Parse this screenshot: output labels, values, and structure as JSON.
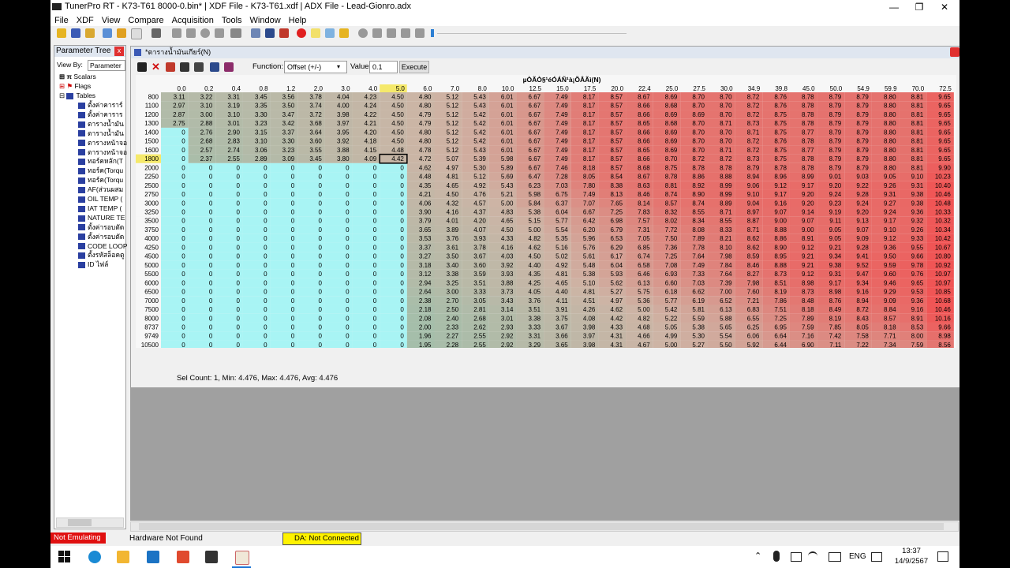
{
  "window": {
    "title": "TunerPro RT - K73-T61  8000-0.bin* | XDF File - K73-T61.xdf | ADX File - Lead-Gionro.adx",
    "minimize": "—",
    "maximize": "❐",
    "close": "✕"
  },
  "menu": [
    "File",
    "XDF",
    "View",
    "Compare",
    "Acquisition",
    "Tools",
    "Window",
    "Help"
  ],
  "param_tree": {
    "title": "Parameter Tree",
    "close": "x",
    "view_by_label": "View By:",
    "view_by_value": "Parameter",
    "groups": [
      "Scalars",
      "Flags",
      "Tables"
    ],
    "tables": [
      "ตั้งค่าคาราร์",
      "ตั้งค่าคาราร",
      "ตารางน้ำมัน",
      "ตารางน้ำมัน",
      "ตารางหน้าจอ",
      "ตารางหน้าจอ",
      "ทอร์คหลัก(T",
      "ทอร์ค(Torqu",
      "ทอร์ค(Torqu",
      "AF(ส่วนผสม",
      "OIL TEMP (",
      "IAT TEMP (",
      "NATURE TE",
      "ตั้งค่ารอบตัด",
      "ตั้งค่ารอบตัด",
      "CODE LOOP",
      "ตั้งรหัสล็อคตู",
      "ID ไฟล์"
    ]
  },
  "table_window": {
    "title": "*ตารางน้ำมันเกียร์(N)",
    "function_label": "Function:",
    "function_value": "Offset (+/-)",
    "value_label": "Value:",
    "value_value": "0.1",
    "execute_label": "Execute",
    "grid_title": "µÒÃÒ§¹éÓÁÑ¹à¡ÕÂÃì(N)",
    "status": "Sel Count: 1, Min: 4.476, Max: 4.476, Avg: 4.476"
  },
  "colors": {
    "cyan": "#a8f4f4",
    "selected_col_header": "#f5e96b",
    "status_red": "#e01010",
    "status_yellow": "#fff200"
  },
  "table_data": {
    "cols": [
      "0.0",
      "0.2",
      "0.4",
      "0.8",
      "1.2",
      "2.0",
      "3.0",
      "4.0",
      "5.0",
      "6.0",
      "7.0",
      "8.0",
      "10.0",
      "12.5",
      "15.0",
      "17.5",
      "20.0",
      "22.4",
      "25.0",
      "27.5",
      "30.0",
      "34.9",
      "39.8",
      "45.0",
      "50.0",
      "54.9",
      "59.9",
      "70.0",
      "72.5"
    ],
    "selected_col": 8,
    "selected_row": 7,
    "rows": [
      {
        "rpm": "800",
        "v": [
          3.11,
          3.22,
          3.31,
          3.45,
          3.56,
          3.78,
          4.04,
          4.23,
          4.5,
          4.8,
          5.12,
          5.43,
          6.01,
          6.67,
          7.49,
          8.17,
          8.57,
          8.67,
          8.69,
          8.7,
          8.7,
          8.72,
          8.76,
          8.78,
          8.79,
          8.79,
          8.8,
          8.81,
          9.65
        ]
      },
      {
        "rpm": "1100",
        "v": [
          2.97,
          3.1,
          3.19,
          3.35,
          3.5,
          3.74,
          4.0,
          4.24,
          4.5,
          4.8,
          5.12,
          5.43,
          6.01,
          6.67,
          7.49,
          8.17,
          8.57,
          8.66,
          8.68,
          8.7,
          8.7,
          8.72,
          8.76,
          8.78,
          8.79,
          8.79,
          8.8,
          8.81,
          9.65
        ]
      },
      {
        "rpm": "1200",
        "v": [
          2.87,
          3.0,
          3.1,
          3.3,
          3.47,
          3.72,
          3.98,
          4.22,
          4.5,
          4.79,
          5.12,
          5.42,
          6.01,
          6.67,
          7.49,
          8.17,
          8.57,
          8.66,
          8.69,
          8.69,
          8.7,
          8.72,
          8.75,
          8.78,
          8.79,
          8.79,
          8.8,
          8.81,
          9.65
        ]
      },
      {
        "rpm": "1300",
        "v": [
          2.75,
          2.88,
          3.01,
          3.23,
          3.42,
          3.68,
          3.97,
          4.21,
          4.5,
          4.79,
          5.12,
          5.42,
          6.01,
          6.67,
          7.49,
          8.17,
          8.57,
          8.65,
          8.68,
          8.7,
          8.71,
          8.73,
          8.75,
          8.78,
          8.79,
          8.79,
          8.8,
          8.81,
          9.65
        ]
      },
      {
        "rpm": "1400",
        "v": [
          0,
          2.76,
          2.9,
          3.15,
          3.37,
          3.64,
          3.95,
          4.2,
          4.5,
          4.8,
          5.12,
          5.42,
          6.01,
          6.67,
          7.49,
          8.17,
          8.57,
          8.66,
          8.69,
          8.7,
          8.7,
          8.71,
          8.75,
          8.77,
          8.79,
          8.79,
          8.8,
          8.81,
          9.65
        ]
      },
      {
        "rpm": "1500",
        "v": [
          0,
          2.68,
          2.83,
          3.1,
          3.3,
          3.6,
          3.92,
          4.18,
          4.5,
          4.8,
          5.12,
          5.42,
          6.01,
          6.67,
          7.49,
          8.17,
          8.57,
          8.66,
          8.69,
          8.7,
          8.7,
          8.72,
          8.76,
          8.78,
          8.79,
          8.79,
          8.8,
          8.81,
          9.65
        ]
      },
      {
        "rpm": "1600",
        "v": [
          0,
          2.57,
          2.74,
          3.06,
          3.23,
          3.55,
          3.88,
          4.15,
          4.48,
          4.78,
          5.12,
          5.43,
          6.01,
          6.67,
          7.49,
          8.17,
          8.57,
          8.65,
          8.69,
          8.7,
          8.71,
          8.72,
          8.75,
          8.77,
          8.79,
          8.79,
          8.8,
          8.81,
          9.65
        ]
      },
      {
        "rpm": "1800",
        "v": [
          0,
          2.37,
          2.55,
          2.89,
          3.09,
          3.45,
          3.8,
          4.09,
          4.42,
          4.72,
          5.07,
          5.39,
          5.98,
          6.67,
          7.49,
          8.17,
          8.57,
          8.66,
          8.7,
          8.72,
          8.72,
          8.73,
          8.75,
          8.78,
          8.79,
          8.79,
          8.8,
          8.81,
          9.65
        ]
      },
      {
        "rpm": "2000",
        "v": [
          0,
          0,
          0,
          0,
          0,
          0,
          0,
          0,
          0,
          4.62,
          4.97,
          5.3,
          5.89,
          6.67,
          7.46,
          8.18,
          8.57,
          8.68,
          8.75,
          8.78,
          8.78,
          8.79,
          8.78,
          8.78,
          8.79,
          8.79,
          8.8,
          8.81,
          9.9
        ]
      },
      {
        "rpm": "2250",
        "v": [
          0,
          0,
          0,
          0,
          0,
          0,
          0,
          0,
          0,
          4.48,
          4.81,
          5.12,
          5.69,
          6.47,
          7.28,
          8.05,
          8.54,
          8.67,
          8.78,
          8.86,
          8.88,
          8.94,
          8.96,
          8.99,
          9.01,
          9.03,
          9.05,
          9.1,
          10.23
        ]
      },
      {
        "rpm": "2500",
        "v": [
          0,
          0,
          0,
          0,
          0,
          0,
          0,
          0,
          0,
          4.35,
          4.65,
          4.92,
          5.43,
          6.23,
          7.03,
          7.8,
          8.38,
          8.63,
          8.81,
          8.92,
          8.99,
          9.06,
          9.12,
          9.17,
          9.2,
          9.22,
          9.26,
          9.31,
          10.4
        ]
      },
      {
        "rpm": "2750",
        "v": [
          0,
          0,
          0,
          0,
          0,
          0,
          0,
          0,
          0,
          4.21,
          4.5,
          4.76,
          5.21,
          5.98,
          6.75,
          7.49,
          8.13,
          8.46,
          8.74,
          8.9,
          8.99,
          9.1,
          9.17,
          9.2,
          9.24,
          9.28,
          9.31,
          9.38,
          10.46
        ]
      },
      {
        "rpm": "3000",
        "v": [
          0,
          0,
          0,
          0,
          0,
          0,
          0,
          0,
          0,
          4.06,
          4.32,
          4.57,
          5.0,
          5.84,
          6.37,
          7.07,
          7.65,
          8.14,
          8.57,
          8.74,
          8.89,
          9.04,
          9.16,
          9.2,
          9.23,
          9.24,
          9.27,
          9.38,
          10.48
        ]
      },
      {
        "rpm": "3250",
        "v": [
          0,
          0,
          0,
          0,
          0,
          0,
          0,
          0,
          0,
          3.9,
          4.16,
          4.37,
          4.83,
          5.38,
          6.04,
          6.67,
          7.25,
          7.83,
          8.32,
          8.55,
          8.71,
          8.97,
          9.07,
          9.14,
          9.19,
          9.2,
          9.24,
          9.36,
          10.33
        ]
      },
      {
        "rpm": "3500",
        "v": [
          0,
          0,
          0,
          0,
          0,
          0,
          0,
          0,
          0,
          3.79,
          4.01,
          4.2,
          4.65,
          5.15,
          5.77,
          6.42,
          6.98,
          7.57,
          8.02,
          8.34,
          8.55,
          8.87,
          9.0,
          9.07,
          9.11,
          9.13,
          9.17,
          9.32,
          10.32
        ]
      },
      {
        "rpm": "3750",
        "v": [
          0,
          0,
          0,
          0,
          0,
          0,
          0,
          0,
          0,
          3.65,
          3.89,
          4.07,
          4.5,
          5.0,
          5.54,
          6.2,
          6.79,
          7.31,
          7.72,
          8.08,
          8.33,
          8.71,
          8.88,
          9.0,
          9.05,
          9.07,
          9.1,
          9.26,
          10.34
        ]
      },
      {
        "rpm": "4000",
        "v": [
          0,
          0,
          0,
          0,
          0,
          0,
          0,
          0,
          0,
          3.53,
          3.76,
          3.93,
          4.33,
          4.82,
          5.35,
          5.96,
          6.53,
          7.05,
          7.5,
          7.89,
          8.21,
          8.62,
          8.86,
          8.91,
          9.05,
          9.09,
          9.12,
          9.33,
          10.42
        ]
      },
      {
        "rpm": "4250",
        "v": [
          0,
          0,
          0,
          0,
          0,
          0,
          0,
          0,
          0,
          3.37,
          3.61,
          3.78,
          4.16,
          4.62,
          5.16,
          5.76,
          6.29,
          6.85,
          7.36,
          7.78,
          8.1,
          8.62,
          8.9,
          9.12,
          9.21,
          9.28,
          9.36,
          9.55,
          10.67
        ]
      },
      {
        "rpm": "4500",
        "v": [
          0,
          0,
          0,
          0,
          0,
          0,
          0,
          0,
          0,
          3.27,
          3.5,
          3.67,
          4.03,
          4.5,
          5.02,
          5.61,
          6.17,
          6.74,
          7.25,
          7.64,
          7.98,
          8.59,
          8.95,
          9.21,
          9.34,
          9.41,
          9.5,
          9.66,
          10.8
        ]
      },
      {
        "rpm": "5000",
        "v": [
          0,
          0,
          0,
          0,
          0,
          0,
          0,
          0,
          0,
          3.18,
          3.4,
          3.6,
          3.92,
          4.4,
          4.92,
          5.48,
          6.04,
          6.58,
          7.08,
          7.49,
          7.84,
          8.46,
          8.88,
          9.21,
          9.38,
          9.52,
          9.59,
          9.78,
          10.92
        ]
      },
      {
        "rpm": "5500",
        "v": [
          0,
          0,
          0,
          0,
          0,
          0,
          0,
          0,
          0,
          3.12,
          3.38,
          3.59,
          3.93,
          4.35,
          4.81,
          5.38,
          5.93,
          6.46,
          6.93,
          7.33,
          7.64,
          8.27,
          8.73,
          9.12,
          9.31,
          9.47,
          9.6,
          9.76,
          10.97
        ]
      },
      {
        "rpm": "6000",
        "v": [
          0,
          0,
          0,
          0,
          0,
          0,
          0,
          0,
          0,
          2.94,
          3.25,
          3.51,
          3.88,
          4.25,
          4.65,
          5.1,
          5.62,
          6.13,
          6.6,
          7.03,
          7.39,
          7.98,
          8.51,
          8.98,
          9.17,
          9.34,
          9.46,
          9.65,
          10.97
        ]
      },
      {
        "rpm": "6500",
        "v": [
          0,
          0,
          0,
          0,
          0,
          0,
          0,
          0,
          0,
          2.64,
          3.0,
          3.33,
          3.73,
          4.05,
          4.4,
          4.81,
          5.27,
          5.75,
          6.18,
          6.62,
          7.0,
          7.6,
          8.19,
          8.73,
          8.98,
          9.16,
          9.29,
          9.53,
          10.85
        ]
      },
      {
        "rpm": "7000",
        "v": [
          0,
          0,
          0,
          0,
          0,
          0,
          0,
          0,
          0,
          2.38,
          2.7,
          3.05,
          3.43,
          3.76,
          4.11,
          4.51,
          4.97,
          5.36,
          5.77,
          6.19,
          6.52,
          7.21,
          7.86,
          8.48,
          8.76,
          8.94,
          9.09,
          9.36,
          10.68
        ]
      },
      {
        "rpm": "7500",
        "v": [
          0,
          0,
          0,
          0,
          0,
          0,
          0,
          0,
          0,
          2.18,
          2.5,
          2.81,
          3.14,
          3.51,
          3.91,
          4.26,
          4.62,
          5.0,
          5.42,
          5.81,
          6.13,
          6.83,
          7.51,
          8.18,
          8.49,
          8.72,
          8.84,
          9.16,
          10.46
        ]
      },
      {
        "rpm": "8000",
        "v": [
          0,
          0,
          0,
          0,
          0,
          0,
          0,
          0,
          0,
          2.08,
          2.4,
          2.68,
          3.01,
          3.38,
          3.75,
          4.08,
          4.42,
          4.82,
          5.22,
          5.59,
          5.88,
          6.55,
          7.25,
          7.89,
          8.19,
          8.43,
          8.57,
          8.91,
          10.16
        ]
      },
      {
        "rpm": "8737",
        "v": [
          0,
          0,
          0,
          0,
          0,
          0,
          0,
          0,
          0,
          2.0,
          2.33,
          2.62,
          2.93,
          3.33,
          3.67,
          3.98,
          4.33,
          4.68,
          5.05,
          5.38,
          5.65,
          6.25,
          6.95,
          7.59,
          7.85,
          8.05,
          8.18,
          8.53,
          9.66
        ]
      },
      {
        "rpm": "9749",
        "v": [
          0,
          0,
          0,
          0,
          0,
          0,
          0,
          0,
          0,
          1.96,
          2.27,
          2.55,
          2.92,
          3.31,
          3.66,
          3.97,
          4.31,
          4.66,
          4.99,
          5.3,
          5.54,
          6.06,
          6.64,
          7.16,
          7.42,
          7.58,
          7.71,
          8.0,
          8.98
        ]
      },
      {
        "rpm": "10500",
        "v": [
          0,
          0,
          0,
          0,
          0,
          0,
          0,
          0,
          0,
          1.95,
          2.28,
          2.55,
          2.92,
          3.29,
          3.65,
          3.98,
          4.31,
          4.67,
          5.0,
          5.27,
          5.5,
          5.92,
          6.44,
          6.9,
          7.11,
          7.22,
          7.34,
          7.59,
          8.56
        ]
      }
    ]
  },
  "statusbar": {
    "emulating": "Not Emulating",
    "hardware": "Hardware Not Found",
    "da": "DA: Not Connected"
  },
  "taskbar": {
    "lang": "ENG",
    "time": "13:37",
    "date": "14/9/2567"
  }
}
